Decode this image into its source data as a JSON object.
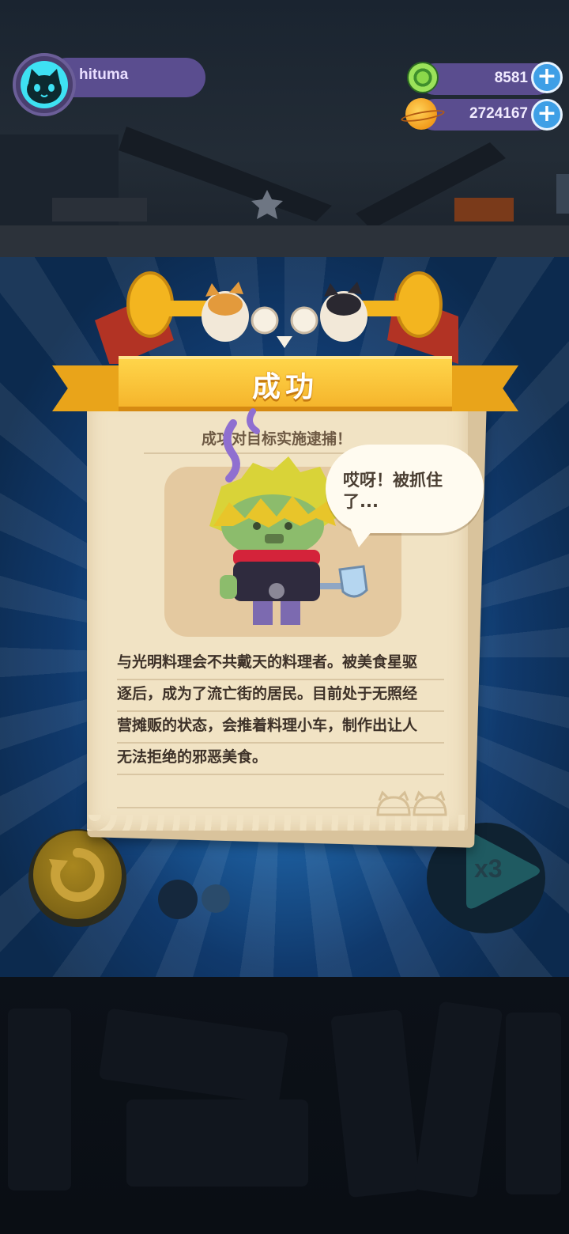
{
  "player": {
    "username": "hituma"
  },
  "currencies": [
    {
      "name": "donut-gem",
      "value": "8581"
    },
    {
      "name": "planet-coin",
      "value": "2724167"
    }
  ],
  "card": {
    "banner_title": "成功",
    "subtitle": "成功对目标实施逮捕！",
    "speech": "哎呀！被抓住了...",
    "description_lines": [
      "与光明料理会不共戴天的料理者。被美食星驱",
      "逐后，成为了流亡街的居民。目前处于无照经",
      "营摊贩的状态，会推着料理小车，制作出让人",
      "无法拒绝的邪恶美食。"
    ]
  },
  "controls": {
    "speed_label": "x3"
  },
  "colors": {
    "banner": "#f5b52c",
    "paper": "#f1e3c4",
    "accent_blue": "#3e9fe6",
    "pill": "#5a4d8f"
  }
}
